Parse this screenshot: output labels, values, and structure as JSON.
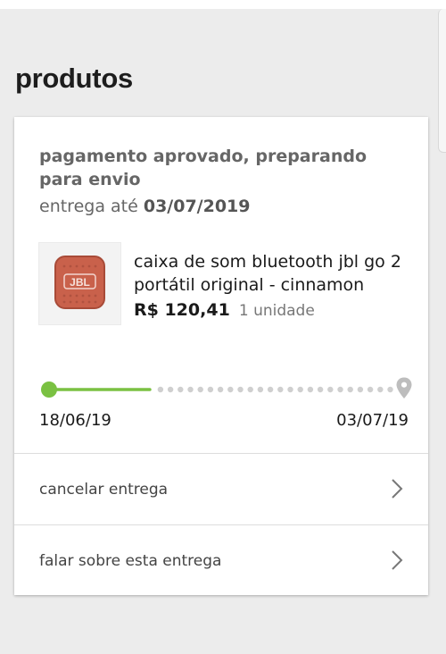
{
  "section": {
    "title": "produtos"
  },
  "order": {
    "status": "pagamento aprovado, preparando para envio",
    "delivery_prefix": "entrega até",
    "delivery_date": "03/07/2019"
  },
  "product": {
    "name": "caixa de som bluetooth jbl go 2 portátil original - cinnamon",
    "price": "R$ 120,41",
    "quantity": "1 unidade",
    "image_brand_text": "JBL"
  },
  "tracking": {
    "start_date": "18/06/19",
    "end_date": "03/07/19",
    "progress": 0.18,
    "active_color": "#7ac142",
    "pending_color": "#cfcfcf",
    "destination_icon": "location-pin-icon"
  },
  "actions": [
    {
      "label": "cancelar entrega",
      "icon": "chevron-right-icon"
    },
    {
      "label": "falar sobre esta entrega",
      "icon": "chevron-right-icon"
    }
  ],
  "colors": {
    "background": "#ececec",
    "card": "#ffffff",
    "accent_green": "#7ac142"
  }
}
